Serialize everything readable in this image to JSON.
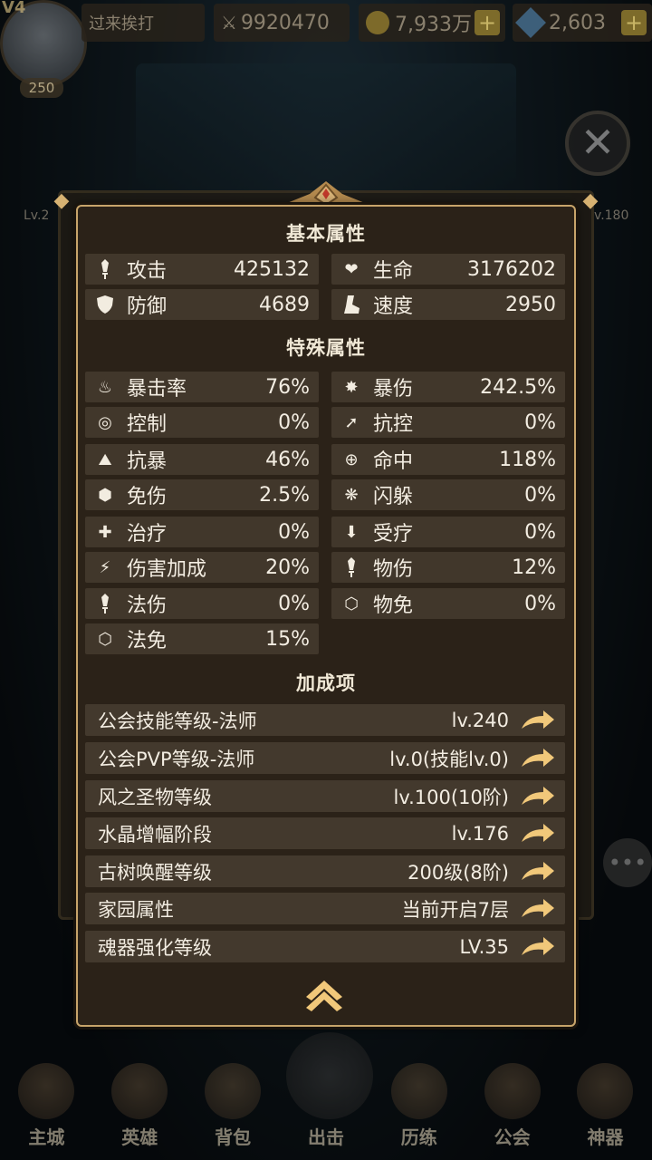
{
  "hud": {
    "vip": "V4",
    "level": "250",
    "player_name": "过来挨打",
    "power": "9920470",
    "gold": "7,933万",
    "gems": "2,603"
  },
  "side": {
    "left_lv": "Lv.2",
    "right_lv": "v.180"
  },
  "panel": {
    "basic_title": "基本属性",
    "basic": [
      {
        "icon": "sword-icon",
        "name": "攻击",
        "value": "425132"
      },
      {
        "icon": "heart-icon",
        "name": "生命",
        "value": "3176202"
      },
      {
        "icon": "shield-icon",
        "name": "防御",
        "value": "4689"
      },
      {
        "icon": "boot-icon",
        "name": "速度",
        "value": "2950"
      }
    ],
    "special_title": "特殊属性",
    "special": [
      {
        "icon": "crit-rate-icon",
        "name": "暴击率",
        "value": "76%"
      },
      {
        "icon": "crit-damage-icon",
        "name": "暴伤",
        "value": "242.5%"
      },
      {
        "icon": "control-icon",
        "name": "控制",
        "value": "0%"
      },
      {
        "icon": "control-resist-icon",
        "name": "抗控",
        "value": "0%"
      },
      {
        "icon": "crit-resist-icon",
        "name": "抗暴",
        "value": "46%"
      },
      {
        "icon": "accuracy-icon",
        "name": "命中",
        "value": "118%"
      },
      {
        "icon": "damage-reduction-icon",
        "name": "免伤",
        "value": "2.5%"
      },
      {
        "icon": "dodge-icon",
        "name": "闪躲",
        "value": "0%"
      },
      {
        "icon": "heal-icon",
        "name": "治疗",
        "value": "0%"
      },
      {
        "icon": "heal-received-icon",
        "name": "受疗",
        "value": "0%"
      },
      {
        "icon": "damage-bonus-icon",
        "name": "伤害加成",
        "value": "20%"
      },
      {
        "icon": "physical-damage-icon",
        "name": "物伤",
        "value": "12%"
      },
      {
        "icon": "magic-damage-icon",
        "name": "法伤",
        "value": "0%"
      },
      {
        "icon": "physical-immunity-icon",
        "name": "物免",
        "value": "0%"
      },
      {
        "icon": "magic-immunity-icon",
        "name": "法免",
        "value": "15%"
      }
    ],
    "bonus_title": "加成项",
    "bonus": [
      {
        "name": "公会技能等级-法师",
        "value": "lv.240"
      },
      {
        "name": "公会PVP等级-法师",
        "value": "lv.0(技能lv.0)"
      },
      {
        "name": "风之圣物等级",
        "value": "lv.100(10阶)"
      },
      {
        "name": "水晶增幅阶段",
        "value": "lv.176"
      },
      {
        "name": "古树唤醒等级",
        "value": "200级(8阶)"
      },
      {
        "name": "家园属性",
        "value": "当前开启7层"
      },
      {
        "name": "魂器强化等级",
        "value": "LV.35"
      }
    ]
  },
  "nav": [
    {
      "label": "主城"
    },
    {
      "label": "英雄"
    },
    {
      "label": "背包"
    },
    {
      "label": "出击"
    },
    {
      "label": "历练"
    },
    {
      "label": "公会"
    },
    {
      "label": "神器"
    }
  ],
  "colors": {
    "panel_bg": "#2b2218",
    "row_bg": "#41372b",
    "border_gold": "#c7a46a",
    "arrow_gold": "#f1c87a"
  }
}
